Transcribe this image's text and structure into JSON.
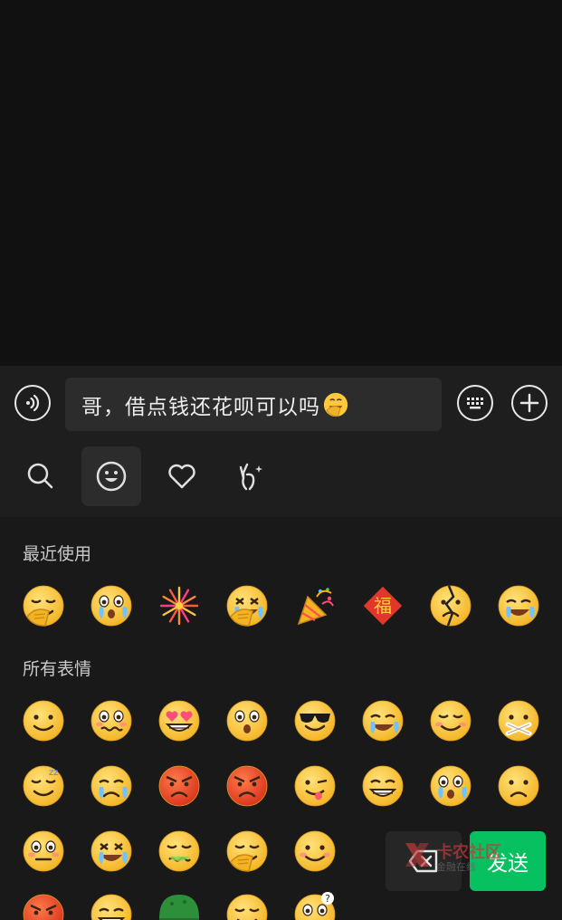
{
  "input": {
    "message_text": "哥，借点钱还花呗可以吗",
    "message_emoji": "facepalm-laugh-emoji"
  },
  "toolbar": {
    "voice_icon": "voice-icon",
    "keyboard_icon": "keyboard-icon",
    "plus_icon": "plus-icon"
  },
  "emoji_tabs": [
    {
      "icon": "search-icon"
    },
    {
      "icon": "smiley-icon",
      "active": true
    },
    {
      "icon": "heart-icon"
    },
    {
      "icon": "gesture-icon"
    }
  ],
  "panel": {
    "recent_title": "最近使用",
    "all_title": "所有表情",
    "recent": [
      "facepalm",
      "hushed-tear",
      "fireworks",
      "facepalm-laugh",
      "party-popper",
      "fu-blessing",
      "broken-face",
      "crying"
    ],
    "all_rows": [
      [
        "smile",
        "worried",
        "heart-eyes",
        "stunned",
        "cool",
        "wail",
        "blush",
        "shut-mouth"
      ],
      [
        "sleepy",
        "tearful-frown",
        "angry-sweat",
        "angry",
        "wink-tongue",
        "grin",
        "surprised-tear",
        "frown"
      ],
      [
        "blush-shock",
        "scream-laugh",
        "sick",
        "facepalm",
        "smile-soft"
      ],
      [
        "angry-red",
        "grin",
        "helmet",
        "smirk",
        "confused"
      ]
    ]
  },
  "actions": {
    "send_label": "发送",
    "delete_icon": "backspace-icon"
  },
  "watermark": {
    "title": "卡农社区",
    "subtitle": "金融在线"
  },
  "colors": {
    "send_green": "#07c160",
    "emoji_yellow": "#fbc93a",
    "background": "#111111"
  }
}
